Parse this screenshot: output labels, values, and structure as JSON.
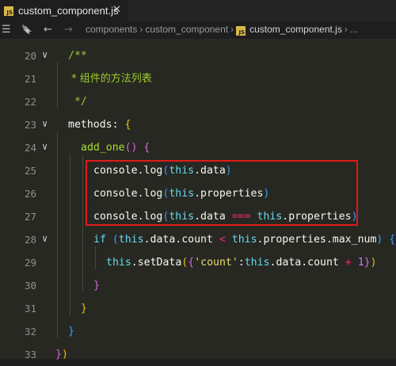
{
  "tab": {
    "badge": "JS",
    "label": "custom_component.js",
    "close": "✕"
  },
  "breadcrumb": {
    "items": [
      "components",
      "custom_component",
      "custom_component.js",
      "..."
    ],
    "sep": "›",
    "badge": "JS"
  },
  "toolbar": {
    "menu": "☰",
    "bookmark": "🔖",
    "back": "←",
    "forward": "→"
  },
  "gutter": {
    "lines": [
      "20",
      "21",
      "22",
      "23",
      "24",
      "25",
      "26",
      "27",
      "28",
      "29",
      "30",
      "31",
      "32",
      "33"
    ],
    "fold": "∨"
  },
  "code": {
    "l20": "/**",
    "l21": " * 组件的方法列表",
    "l22": " */",
    "l23": {
      "prop": "methods",
      "colon": ":",
      "brace": "{"
    },
    "l24": {
      "name": "add_one",
      "parens": "()",
      "brace": "{"
    },
    "l25": {
      "obj": "console",
      "dot": ".",
      "fn": "log",
      "open": "(",
      "kw": "this",
      "rest": ".data",
      "close": ")"
    },
    "l26": {
      "obj": "console",
      "dot": ".",
      "fn": "log",
      "open": "(",
      "kw": "this",
      "rest": ".properties",
      "close": ")"
    },
    "l27": {
      "obj": "console",
      "dot": ".",
      "fn": "log",
      "open": "(",
      "kw": "this",
      "rest": ".data",
      "op": "===",
      "kw2": "this",
      "rest2": ".properties",
      "close": ")"
    },
    "l28": {
      "kw_if": "if",
      "open": "(",
      "kw": "this",
      "rest": ".data.count",
      "op": "<",
      "kw2": "this",
      "rest2": ".properties.max_num",
      "close": ")",
      "brace": "{"
    },
    "l29": {
      "kw": "this",
      "dot": ".",
      "fn": "setData",
      "open": "(",
      "brace_open": "{",
      "str": "'count'",
      "colon": ":",
      "kw2": "this",
      "rest": ".data.count",
      "op": "+",
      "num": "1",
      "brace_close": "}",
      "close": ")"
    },
    "l30": "}",
    "l31": "}",
    "l32": "}",
    "l33": {
      "brace": "}",
      "paren": ")"
    }
  },
  "colors": {
    "background": "#272822",
    "comment": "#9ccc2c",
    "keyword": "#66d9ef",
    "function": "#a6e22e",
    "string": "#e6db74",
    "number": "#ae81ff",
    "operator": "#f92672",
    "highlight_box": "#e01a1a"
  }
}
